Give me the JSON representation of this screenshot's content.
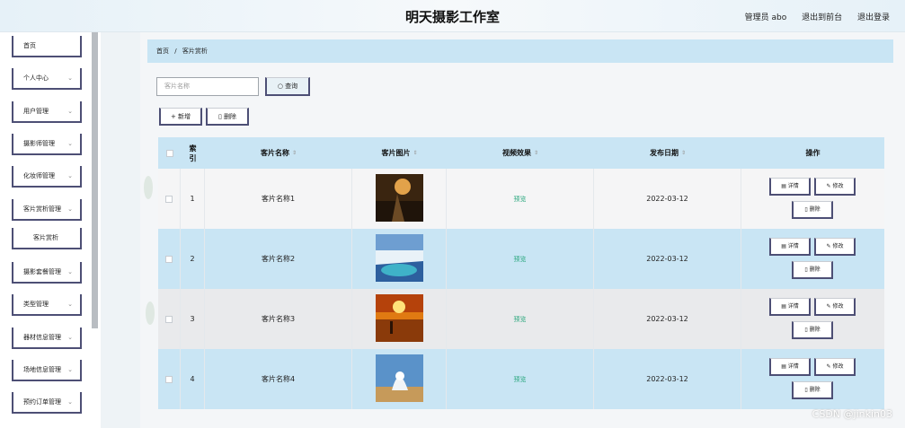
{
  "header": {
    "title": "明天摄影工作室",
    "admin": "管理员 abo",
    "exit_front": "退出到前台",
    "logout": "退出登录"
  },
  "sidebar": {
    "items": [
      {
        "label": "首页",
        "chevron": false
      },
      {
        "label": "个人中心",
        "chevron": true
      },
      {
        "label": "用户管理",
        "chevron": true
      },
      {
        "label": "摄影师管理",
        "chevron": true
      },
      {
        "label": "化妆师管理",
        "chevron": true
      },
      {
        "label": "客片赏析管理",
        "chevron": true
      },
      {
        "label": "客片赏析",
        "chevron": false,
        "sub": true
      },
      {
        "label": "摄影套餐管理",
        "chevron": true
      },
      {
        "label": "类型管理",
        "chevron": true
      },
      {
        "label": "器材信息管理",
        "chevron": true
      },
      {
        "label": "场地信息管理",
        "chevron": true
      },
      {
        "label": "预约订单管理",
        "chevron": true
      }
    ]
  },
  "breadcrumb": {
    "home": "首页",
    "sep": "/",
    "current": "客片赏析"
  },
  "search": {
    "placeholder": "客片名称",
    "button": "查询",
    "button_icon": "search-icon"
  },
  "actions": {
    "add": "新增",
    "add_icon": "plus-icon",
    "delete": "删除",
    "delete_icon": "trash-icon"
  },
  "table": {
    "columns": {
      "index": "索引",
      "name": "客片名称",
      "image": "客片图片",
      "video": "视频效果",
      "date": "发布日期",
      "ops": "操作"
    },
    "rows": [
      {
        "index": "1",
        "name": "客片名称1",
        "video": "预览",
        "date": "2022-03-12",
        "bg": "#f5f5f6"
      },
      {
        "index": "2",
        "name": "客片名称2",
        "video": "预览",
        "date": "2022-03-12",
        "bg": "#c9e5f4"
      },
      {
        "index": "3",
        "name": "客片名称3",
        "video": "预览",
        "date": "2022-03-12",
        "bg": "#e9eaec"
      },
      {
        "index": "4",
        "name": "客片名称4",
        "video": "预览",
        "date": "2022-03-12",
        "bg": "#c9e5f4"
      }
    ],
    "op_detail": "详情",
    "op_edit": "修改",
    "op_delete": "删除"
  },
  "watermark": "CSDN @jinkin03"
}
